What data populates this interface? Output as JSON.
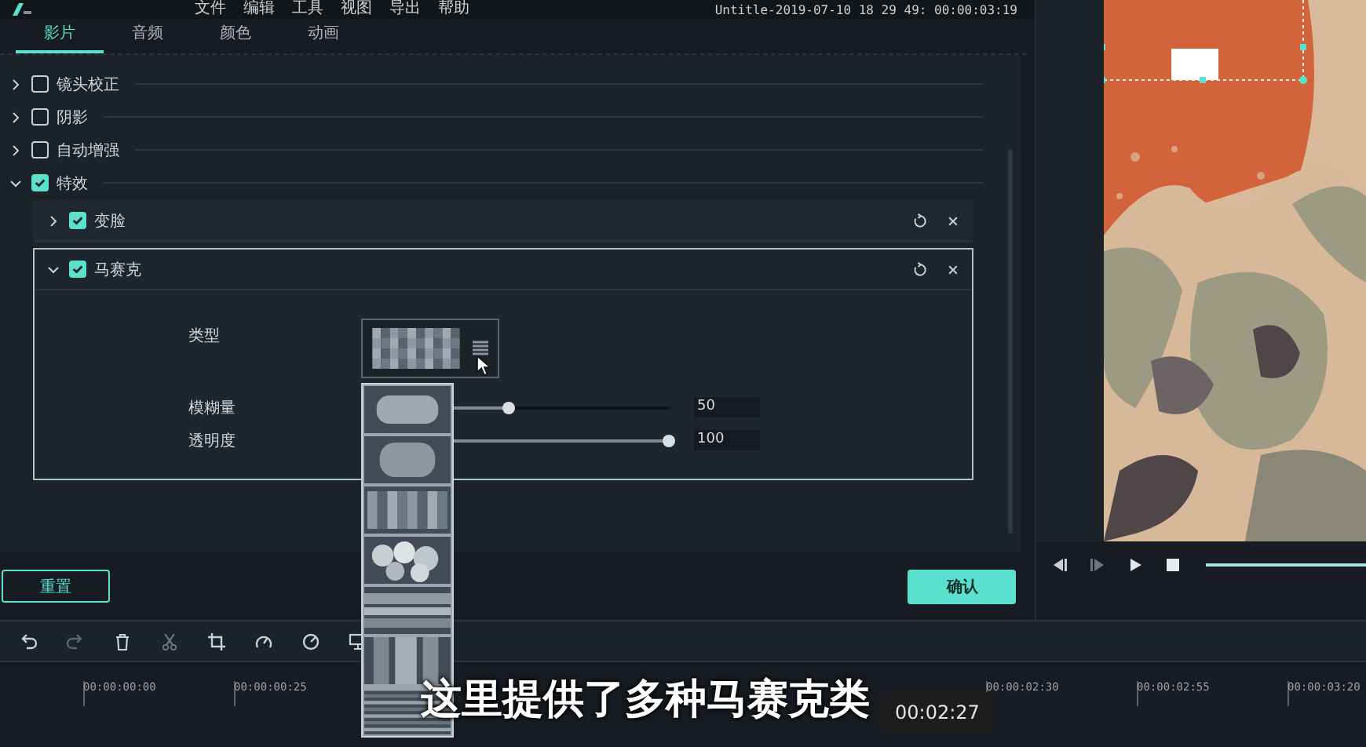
{
  "menu": [
    "文件",
    "编辑",
    "工具",
    "视图",
    "导出",
    "帮助"
  ],
  "project_title": "Untitle-2019-07-10 18 29 49: 00:00:03:19",
  "tabs": [
    {
      "label": "影片",
      "selected": true
    },
    {
      "label": "音频",
      "selected": false
    },
    {
      "label": "颜色",
      "selected": false
    },
    {
      "label": "动画",
      "selected": false
    }
  ],
  "properties": [
    {
      "label": "镜头校正",
      "checked": false,
      "expanded": false
    },
    {
      "label": "阴影",
      "checked": false,
      "expanded": false
    },
    {
      "label": "自动增强",
      "checked": false,
      "expanded": false
    },
    {
      "label": "特效",
      "checked": true,
      "expanded": true,
      "children": [
        {
          "label": "变脸",
          "checked": true,
          "expanded": false
        },
        {
          "label": "马赛克",
          "checked": true,
          "expanded": true,
          "type_label": "类型",
          "sliders": [
            {
              "label": "模糊量",
              "level": 0.48,
              "value": "50"
            },
            {
              "label": "透明度",
              "level": 1,
              "value": "100"
            }
          ]
        }
      ]
    }
  ],
  "type_options": [
    {
      "kind": "soft"
    },
    {
      "kind": "blur"
    },
    {
      "kind": "mosaic"
    },
    {
      "kind": "bokeh"
    },
    {
      "kind": "hbars"
    },
    {
      "kind": "vbars"
    },
    {
      "kind": "lines"
    }
  ],
  "buttons": {
    "reset": "重置",
    "confirm": "确认"
  },
  "ruler_left": [
    "00:00:00:00",
    "00:00:00:25"
  ],
  "ruler_right": [
    "00:00:02:30",
    "00:00:02:55",
    "00:00:03:20"
  ],
  "subtitle": "这里提供了多种马赛克类",
  "timestamp": "00:02:27"
}
